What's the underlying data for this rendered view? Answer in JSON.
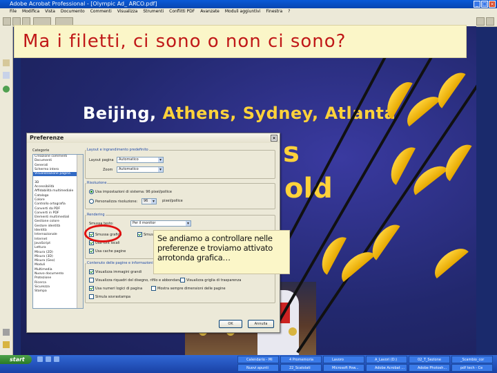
{
  "window": {
    "title": "Adobe Acrobat Professional - [Olympic Ad_ ARCO.pdf]"
  },
  "menu": [
    "File",
    "Modifica",
    "Vista",
    "Documento",
    "Commenti",
    "Visualizza",
    "Strumenti",
    "Conflitti PDF",
    "Avanzate",
    "Moduli aggiuntivi",
    "Finestra",
    "?"
  ],
  "toolbar": {
    "save": "Salva",
    "search": "Cerca"
  },
  "slide_title": "Ma i filetti, ci sono o non ci sono?",
  "document": {
    "heading_white": "Beijing,",
    "heading_yellow": "Athens, Sydney, Atlanta",
    "word_s": "s",
    "word_gold": "old"
  },
  "dialog": {
    "title": "Preferenze",
    "categories_label": "Categorie",
    "categories": [
      "Creazione commenti",
      "Documenti",
      "Generali",
      "Schermo intero",
      "Visualizzazione pagina",
      "",
      "3D",
      "Accessibilità",
      "Affidabilità multimediale",
      "Catalogo",
      "Colore",
      "Controllo ortografia",
      "Converti da PDF",
      "Converti in PDF",
      "Elementi multimediali",
      "Gestione colore",
      "Gestore identità",
      "Identità",
      "Internazionale",
      "Internet",
      "JavaScript",
      "Lettura",
      "Misura (2D)",
      "Misura (3D)",
      "Misura (Geo)",
      "Moduli",
      "Multimedia",
      "Nuovo documento",
      "Protezione",
      "Ricerca",
      "Sicurezza",
      "Stampa"
    ],
    "selected_category": "Visualizzazione pagina",
    "layout_group": "Layout e ingrandimento predefinito",
    "layout_label": "Layout pagina",
    "layout_value": "Automatico",
    "zoom_label": "Zoom",
    "zoom_value": "Automatico",
    "resolution_group": "Risoluzione",
    "use_system": "Usa impostazioni di sistema:",
    "system_value": "96",
    "ppi": "pixel/pollice",
    "custom_res": "Personalizza risoluzione:",
    "custom_value": "96",
    "ppi_short": "pixel/pollice",
    "rendering_group": "Rendering",
    "smooth_text": "Smussa testo:",
    "smooth_value": "Per il monitor",
    "smooth_line": "Smussa grafica",
    "smooth_images": "Smussa immagini",
    "use_cache": "Usa cache pagine",
    "use_local_fonts": "Usa font locali",
    "contents_group": "Contenuto delle pagine e informazioni",
    "large_images": "Visualizza immagini grandi",
    "transparency": "Simula sovrastampa",
    "art_trim": "Visualizza riquadri del disegno, rifilo e abbondanza",
    "transparency_grid": "Visualizza griglia di trasparenza",
    "logical_page": "Usa numeri logici di pagina",
    "page_size": "Mostra sempre dimensioni delle pagine",
    "ok": "OK",
    "cancel": "Annulla"
  },
  "callout": "Se andiamo a controllare nelle preferenze e troviamo attivato arrotonda grafica…",
  "taskbar": {
    "start": "start",
    "tasks_top": [
      "Calendario - Mi",
      "4 Promemoria",
      "Lavoro",
      "A_Lavori (D:)",
      "02_T_Sezione",
      "_Scambio_cor"
    ],
    "tasks_bottom": [
      "Nuovi apunti",
      "22_Scatolati",
      "Microsoft Pow...",
      "Adobe Acrobat ...",
      "Adobe Photosh...",
      "pdf tech - Ce"
    ]
  },
  "colors": {
    "accent_red": "#c01818",
    "highlight_yellow": "#ffd23a"
  }
}
